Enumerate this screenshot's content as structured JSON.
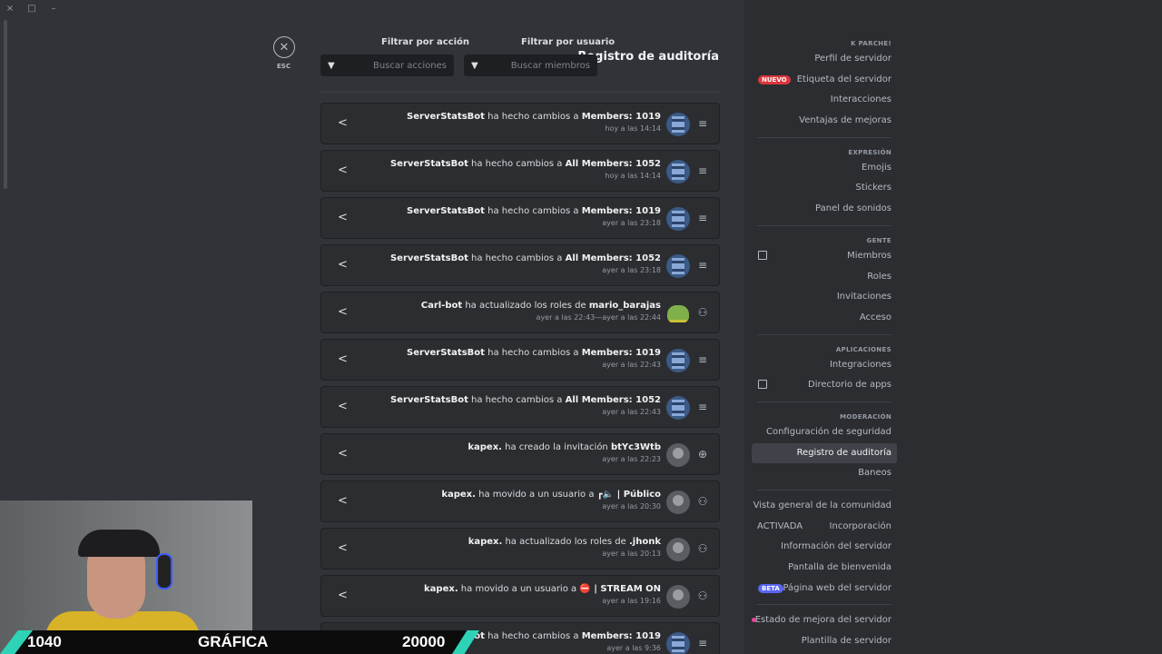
{
  "window": {
    "close": "×",
    "maximize": "□",
    "minimize": "–"
  },
  "header": {
    "title": "Registro de auditoría",
    "filter_user_label": "Filtrar por usuario",
    "filter_user_placeholder": "Buscar miembros",
    "filter_action_label": "Filtrar por acción",
    "filter_action_placeholder": "Buscar acciones",
    "close_label": "ESC"
  },
  "entries": [
    {
      "actor": "ServerStatsBot",
      "action": " ha hecho cambios a ",
      "target": "Members: 1019",
      "time": "hoy a las 14:14",
      "avatar": "server",
      "icon": "channel-edit"
    },
    {
      "actor": "ServerStatsBot",
      "action": " ha hecho cambios a ",
      "target": "All Members: 1052",
      "time": "hoy a las 14:14",
      "avatar": "server",
      "icon": "channel-edit"
    },
    {
      "actor": "ServerStatsBot",
      "action": " ha hecho cambios a ",
      "target": "Members: 1019",
      "time": "ayer a las 23:18",
      "avatar": "server",
      "icon": "channel-edit"
    },
    {
      "actor": "ServerStatsBot",
      "action": " ha hecho cambios a ",
      "target": "All Members: 1052",
      "time": "ayer a las 23:18",
      "avatar": "server",
      "icon": "channel-edit"
    },
    {
      "actor": "Carl-bot",
      "action": " ha actualizado los roles de ",
      "target": "mario_barajas",
      "time": "ayer a las 22:43—ayer a las 22:44",
      "avatar": "turtle",
      "icon": "member-roles"
    },
    {
      "actor": "ServerStatsBot",
      "action": " ha hecho cambios a ",
      "target": "Members: 1019",
      "time": "ayer a las 22:43",
      "avatar": "server",
      "icon": "channel-edit"
    },
    {
      "actor": "ServerStatsBot",
      "action": " ha hecho cambios a ",
      "target": "All Members: 1052",
      "time": "ayer a las 22:43",
      "avatar": "server",
      "icon": "channel-edit"
    },
    {
      "actor": "kapex.",
      "action": " ha creado la invitación ",
      "target": "btYc3Wtb",
      "time": "ayer a las 22:23",
      "avatar": "person",
      "icon": "invite"
    },
    {
      "actor": "kapex.",
      "action": " ha movido a un usuario a ",
      "target": "┏🔈 | Público",
      "time": "ayer a las 20:30",
      "avatar": "person",
      "icon": "member-move"
    },
    {
      "actor": "kapex.",
      "action": " ha actualizado los roles de ",
      "target": ".jhonk",
      "time": "ayer a las 20:13",
      "avatar": "person",
      "icon": "member-roles"
    },
    {
      "actor": "kapex.",
      "action": " ha movido a un usuario a ",
      "target": "⛔ | STREAM ON",
      "time": "ayer a las 19:16",
      "avatar": "person",
      "icon": "member-move"
    },
    {
      "actor": "ServerStatsBot",
      "action": " ha hecho cambios a ",
      "target": "Members: 1019",
      "time": "ayer a las 9:36",
      "avatar": "server",
      "icon": "channel-edit"
    }
  ],
  "sidebar": {
    "server_header": "K PARCHE!",
    "server_items": [
      {
        "label": "Perfil de servidor"
      },
      {
        "label": "Etiqueta del servidor",
        "badge": "NUEVO"
      },
      {
        "label": "Interacciones"
      },
      {
        "label": "Ventajas de mejoras"
      }
    ],
    "expression_header": "EXPRESIÓN",
    "expression_items": [
      {
        "label": "Emojis"
      },
      {
        "label": "Stickers"
      },
      {
        "label": "Panel de sonidos"
      }
    ],
    "people_header": "GENTE",
    "people_items": [
      {
        "label": "Miembros"
      },
      {
        "label": "Roles"
      },
      {
        "label": "Invitaciones"
      },
      {
        "label": "Acceso"
      }
    ],
    "apps_header": "APLICACIONES",
    "apps_items": [
      {
        "label": "Integraciones"
      },
      {
        "label": "Directorio de apps"
      }
    ],
    "moderation_header": "MODERACIÓN",
    "moderation_items": [
      {
        "label": "Configuración de seguridad"
      },
      {
        "label": "Registro de auditoría",
        "selected": true
      },
      {
        "label": "Baneos"
      }
    ],
    "community_items": [
      {
        "label": "Vista general de la comunidad"
      },
      {
        "label": "Incorporación",
        "status": "ACTIVADA"
      },
      {
        "label": "Información del servidor"
      },
      {
        "label": "Pantalla de bienvenida"
      },
      {
        "label": "Página web del servidor",
        "badge": "BETA"
      }
    ],
    "extra_items": [
      {
        "label": "Estado de mejora del servidor"
      },
      {
        "label": "Plantilla de servidor"
      }
    ]
  },
  "stream_overlay": {
    "left_number": "1040",
    "label": "GRÁFICA",
    "right_number": "20000"
  }
}
